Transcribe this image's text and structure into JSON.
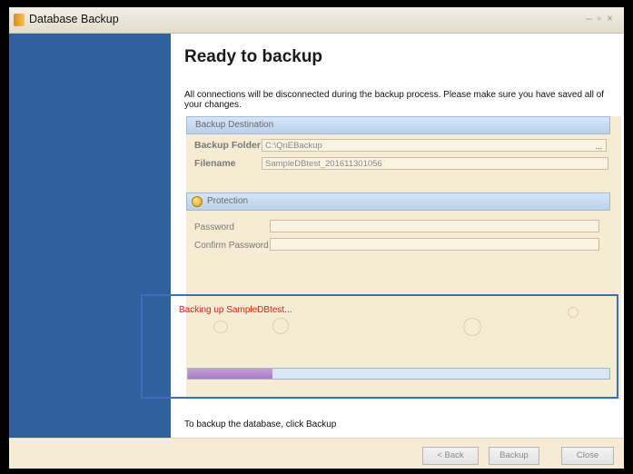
{
  "window": {
    "title": "Database Backup"
  },
  "main": {
    "heading": "Ready to backup",
    "intro": "All connections will be disconnected during the backup process. Please make sure you have saved all of your changes.",
    "destination": {
      "header": "Backup Destination",
      "folder_label": "Backup Folder",
      "folder_value": "C:\\QnEBackup",
      "browse_label": "...",
      "filename_label": "Filename",
      "filename_value": "SampleDBtest_201611301056"
    },
    "protection": {
      "header": "Protection",
      "password_label": "Password",
      "confirm_label": "Confirm Password"
    },
    "status": "Backing up SampleDBtest...",
    "progress_fraction": 0.2,
    "instruction": "To backup the database, click Backup"
  },
  "footer": {
    "back_label": "< Back",
    "backup_label": "Backup",
    "close_label": "Close"
  },
  "colors": {
    "sidebar": "#30609d",
    "status": "#e0201a",
    "progress_fill": "#b88ccc"
  }
}
